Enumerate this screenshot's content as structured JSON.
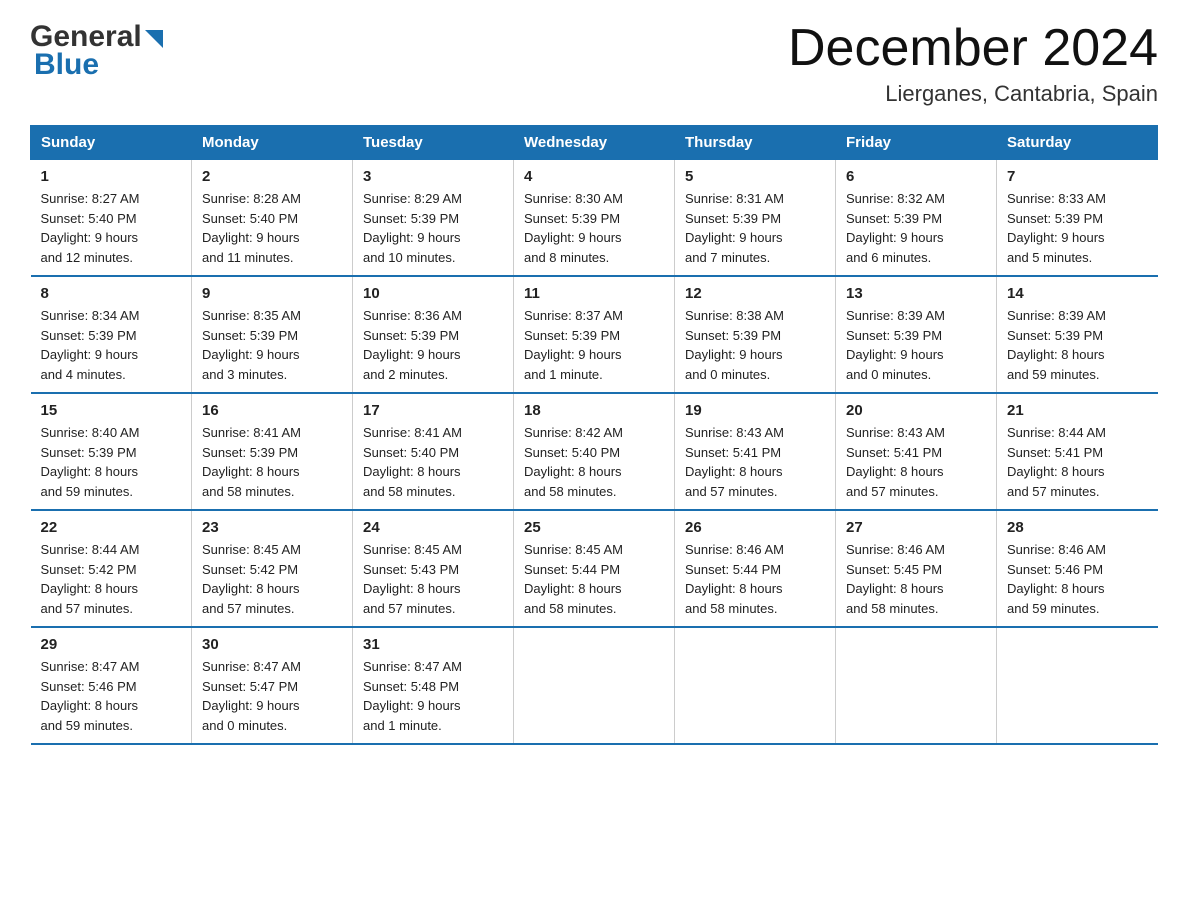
{
  "logo": {
    "general": "General",
    "blue": "Blue"
  },
  "title": {
    "month_year": "December 2024",
    "location": "Lierganes, Cantabria, Spain"
  },
  "days_of_week": [
    "Sunday",
    "Monday",
    "Tuesday",
    "Wednesday",
    "Thursday",
    "Friday",
    "Saturday"
  ],
  "weeks": [
    [
      {
        "day": "1",
        "sunrise": "8:27 AM",
        "sunset": "5:40 PM",
        "daylight": "9 hours and 12 minutes."
      },
      {
        "day": "2",
        "sunrise": "8:28 AM",
        "sunset": "5:40 PM",
        "daylight": "9 hours and 11 minutes."
      },
      {
        "day": "3",
        "sunrise": "8:29 AM",
        "sunset": "5:39 PM",
        "daylight": "9 hours and 10 minutes."
      },
      {
        "day": "4",
        "sunrise": "8:30 AM",
        "sunset": "5:39 PM",
        "daylight": "9 hours and 8 minutes."
      },
      {
        "day": "5",
        "sunrise": "8:31 AM",
        "sunset": "5:39 PM",
        "daylight": "9 hours and 7 minutes."
      },
      {
        "day": "6",
        "sunrise": "8:32 AM",
        "sunset": "5:39 PM",
        "daylight": "9 hours and 6 minutes."
      },
      {
        "day": "7",
        "sunrise": "8:33 AM",
        "sunset": "5:39 PM",
        "daylight": "9 hours and 5 minutes."
      }
    ],
    [
      {
        "day": "8",
        "sunrise": "8:34 AM",
        "sunset": "5:39 PM",
        "daylight": "9 hours and 4 minutes."
      },
      {
        "day": "9",
        "sunrise": "8:35 AM",
        "sunset": "5:39 PM",
        "daylight": "9 hours and 3 minutes."
      },
      {
        "day": "10",
        "sunrise": "8:36 AM",
        "sunset": "5:39 PM",
        "daylight": "9 hours and 2 minutes."
      },
      {
        "day": "11",
        "sunrise": "8:37 AM",
        "sunset": "5:39 PM",
        "daylight": "9 hours and 1 minute."
      },
      {
        "day": "12",
        "sunrise": "8:38 AM",
        "sunset": "5:39 PM",
        "daylight": "9 hours and 0 minutes."
      },
      {
        "day": "13",
        "sunrise": "8:39 AM",
        "sunset": "5:39 PM",
        "daylight": "9 hours and 0 minutes."
      },
      {
        "day": "14",
        "sunrise": "8:39 AM",
        "sunset": "5:39 PM",
        "daylight": "8 hours and 59 minutes."
      }
    ],
    [
      {
        "day": "15",
        "sunrise": "8:40 AM",
        "sunset": "5:39 PM",
        "daylight": "8 hours and 59 minutes."
      },
      {
        "day": "16",
        "sunrise": "8:41 AM",
        "sunset": "5:39 PM",
        "daylight": "8 hours and 58 minutes."
      },
      {
        "day": "17",
        "sunrise": "8:41 AM",
        "sunset": "5:40 PM",
        "daylight": "8 hours and 58 minutes."
      },
      {
        "day": "18",
        "sunrise": "8:42 AM",
        "sunset": "5:40 PM",
        "daylight": "8 hours and 58 minutes."
      },
      {
        "day": "19",
        "sunrise": "8:43 AM",
        "sunset": "5:41 PM",
        "daylight": "8 hours and 57 minutes."
      },
      {
        "day": "20",
        "sunrise": "8:43 AM",
        "sunset": "5:41 PM",
        "daylight": "8 hours and 57 minutes."
      },
      {
        "day": "21",
        "sunrise": "8:44 AM",
        "sunset": "5:41 PM",
        "daylight": "8 hours and 57 minutes."
      }
    ],
    [
      {
        "day": "22",
        "sunrise": "8:44 AM",
        "sunset": "5:42 PM",
        "daylight": "8 hours and 57 minutes."
      },
      {
        "day": "23",
        "sunrise": "8:45 AM",
        "sunset": "5:42 PM",
        "daylight": "8 hours and 57 minutes."
      },
      {
        "day": "24",
        "sunrise": "8:45 AM",
        "sunset": "5:43 PM",
        "daylight": "8 hours and 57 minutes."
      },
      {
        "day": "25",
        "sunrise": "8:45 AM",
        "sunset": "5:44 PM",
        "daylight": "8 hours and 58 minutes."
      },
      {
        "day": "26",
        "sunrise": "8:46 AM",
        "sunset": "5:44 PM",
        "daylight": "8 hours and 58 minutes."
      },
      {
        "day": "27",
        "sunrise": "8:46 AM",
        "sunset": "5:45 PM",
        "daylight": "8 hours and 58 minutes."
      },
      {
        "day": "28",
        "sunrise": "8:46 AM",
        "sunset": "5:46 PM",
        "daylight": "8 hours and 59 minutes."
      }
    ],
    [
      {
        "day": "29",
        "sunrise": "8:47 AM",
        "sunset": "5:46 PM",
        "daylight": "8 hours and 59 minutes."
      },
      {
        "day": "30",
        "sunrise": "8:47 AM",
        "sunset": "5:47 PM",
        "daylight": "9 hours and 0 minutes."
      },
      {
        "day": "31",
        "sunrise": "8:47 AM",
        "sunset": "5:48 PM",
        "daylight": "9 hours and 1 minute."
      },
      null,
      null,
      null,
      null
    ]
  ],
  "labels": {
    "sunrise": "Sunrise:",
    "sunset": "Sunset:",
    "daylight": "Daylight:"
  }
}
